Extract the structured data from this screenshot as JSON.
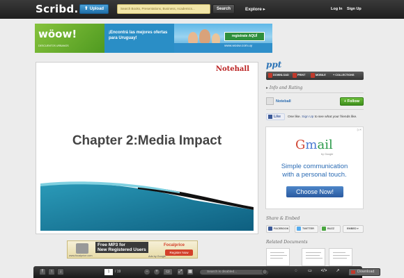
{
  "header": {
    "logo": "Scribd.",
    "upload_label": "Upload",
    "search_placeholder": "Search Books, Presentations, Business, Academics...",
    "search_button": "Search",
    "explore_label": "Explore ▸",
    "login_label": "Log In",
    "signup_label": "Sign Up"
  },
  "banner_ad": {
    "logo": "wöow!",
    "logo_sub": "DESCUENTOS URBANOS",
    "promo": "¡Encontrá las mejores ofertas para Uruguay!",
    "cta": "registrate AQUÍ",
    "url": "www.woow.com.uy"
  },
  "document": {
    "slide_logo": "Notehall",
    "slide_title": "Chapter 2:Media Impact"
  },
  "bottom_ad": {
    "headline_1": "Free MP3 for",
    "headline_2": "New Registered Users",
    "brand": "Focalprice",
    "cta": "Register Now",
    "site": "www.focalprice.com",
    "ads_by": "Ads by Google"
  },
  "toolbar": {
    "page_current": "1",
    "page_total": "/ 19",
    "search_placeholder": "Search is disabled...",
    "download_label": "Download"
  },
  "sidebar": {
    "doc_title": "ppt",
    "actions": [
      "DOWNLOAD",
      "PRINT",
      "MOBILE",
      "+ COLLECTIONS"
    ],
    "info_label": "Info and Rating",
    "uploader": "Noteball",
    "follow_label": "Follow",
    "fb_like": "Like",
    "fb_count_text": "One like.",
    "fb_signup": "Sign Up",
    "fb_suffix": "to see what your friends like.",
    "share_title": "Share & Embed",
    "share_buttons": [
      "FACEBOOK",
      "TWITTER",
      "BUZZ",
      "EMBED"
    ],
    "related_title": "Related Documents"
  },
  "gmail_ad": {
    "logo_g1": "G",
    "logo_g2": "m",
    "logo_g3": "ail",
    "by_google": "by Google",
    "line1": "Simple communication",
    "line2": "with a personal touch.",
    "cta": "Choose Now!"
  },
  "colors": {
    "topbar": "#262626",
    "accent_blue": "#2b73b6",
    "follow_green": "#4fa02a",
    "gmail_button": "#3a70b8"
  }
}
